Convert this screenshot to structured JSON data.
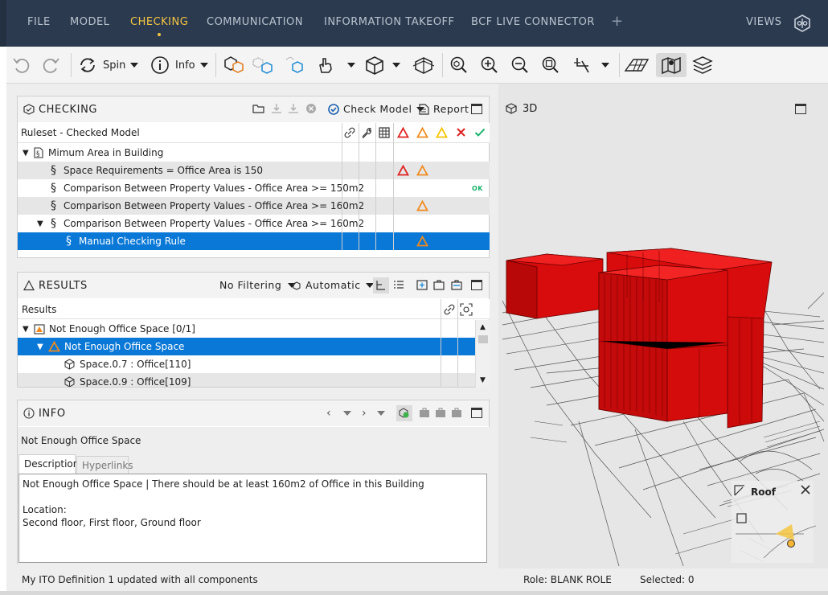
{
  "menu": {
    "items": [
      "FILE",
      "MODEL",
      "CHECKING",
      "COMMUNICATION",
      "INFORMATION TAKEOFF",
      "BCF LIVE CONNECTOR"
    ],
    "active": "CHECKING",
    "plus": "+",
    "views": "VIEWS"
  },
  "toolbar": {
    "spin_label": "Spin",
    "info_label": "Info"
  },
  "checking": {
    "title": "CHECKING",
    "check_model_label": "Check Model",
    "report_label": "Report",
    "column_header": "Ruleset - Checked Model",
    "rows": [
      {
        "label": "Mimum Area in Building",
        "status": ""
      },
      {
        "label": "Space Requirements = Office Area is 150",
        "status": ""
      },
      {
        "label": "Comparison Between Property Values - Office Area >= 150m2",
        "status": "OK"
      },
      {
        "label": "Comparison Between Property Values - Office Area >= 160m2",
        "status": ""
      },
      {
        "label": "Comparison Between Property Values - Office Area >= 160m2",
        "status": ""
      },
      {
        "label": "Manual Checking Rule",
        "status": ""
      }
    ],
    "section_symbol": "§"
  },
  "results": {
    "title": "RESULTS",
    "filter_label": "No Filtering",
    "mode_label": "Automatic",
    "column_header": "Results",
    "rows": [
      {
        "label": "Not Enough Office Space [0/1]"
      },
      {
        "label": "Not Enough Office Space"
      },
      {
        "label": "Space.0.7 : Office[110]"
      },
      {
        "label": "Space.0.9 : Office[109]"
      }
    ]
  },
  "info": {
    "title": "INFO",
    "subject": "Not Enough Office Space",
    "tabs": [
      "Description",
      "Hyperlinks"
    ],
    "description_line1": "Not Enough Office Space | There should be at least 160m2 of Office in this Building",
    "location_label": "Location:",
    "location_value": "Second floor, First floor, Ground floor"
  },
  "status": {
    "message": "My ITO Definition 1 updated with all components",
    "role": "Role: BLANK ROLE",
    "selected": "Selected: 0"
  },
  "view3d": {
    "title": "3D",
    "roof_label": "Roof"
  },
  "colors": {
    "menu_bg": "#2b3a4f",
    "accent": "#f5c542",
    "selection": "#0a78d7",
    "model_red": "#e01010",
    "error_red": "#e02020",
    "warning_orange": "#f08a1c",
    "warning_yellow": "#f5c400",
    "ok_green": "#17b26a"
  }
}
